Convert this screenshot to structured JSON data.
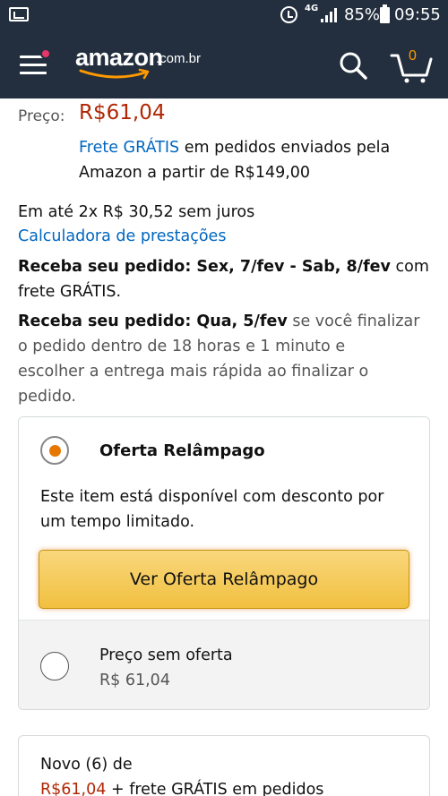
{
  "status_bar": {
    "network": "4G",
    "battery": "85%",
    "time": "09:55",
    "icons": [
      "screenshot-icon",
      "alarm-icon",
      "signal-icon",
      "battery-icon"
    ]
  },
  "header": {
    "logo_word": "amazon",
    "logo_domain": ".com.br",
    "cart_count": "0",
    "colors": {
      "background": "#232f3e",
      "accent": "#ff9900",
      "notification": "#e8366b"
    }
  },
  "product": {
    "price_label": "Preço:",
    "price": "R$61,04",
    "shipping_link": "Frete GRÁTIS",
    "shipping_text_1": " em pedidos enviados pela",
    "shipping_text_2": "Amazon a partir de R$149,00",
    "installments": "Em até 2x R$ 30,52 sem juros",
    "calculator_link": "Calculadora de prestações",
    "delivery_1_bold": "Receba seu pedido: Sex, 7/fev - Sab, 8/fev",
    "delivery_1_rest_a": " com",
    "delivery_1_rest_b": "frete GRÁTIS.",
    "delivery_2_bold": "Receba seu pedido: Qua, 5/fev",
    "delivery_2_rest_a": " se você finalizar",
    "delivery_2_line_2": "o pedido dentro de 18 horas e 1 minuto e",
    "delivery_2_line_3": "escolher a entrega mais rápida ao finalizar o",
    "delivery_2_line_4": "pedido."
  },
  "offer": {
    "deal_title": "Oferta Relâmpago",
    "deal_desc_1": "Este item está disponível com desconto por",
    "deal_desc_2": "um tempo limitado.",
    "deal_button": "Ver Oferta Relâmpago",
    "no_offer_title": "Preço sem oferta",
    "no_offer_price": "R$ 61,04",
    "selected": "Oferta Relâmpago"
  },
  "new_offers": {
    "label": "Novo (6) de",
    "price": "R$61,04",
    "suffix": " + frete GRÁTIS em pedidos"
  }
}
